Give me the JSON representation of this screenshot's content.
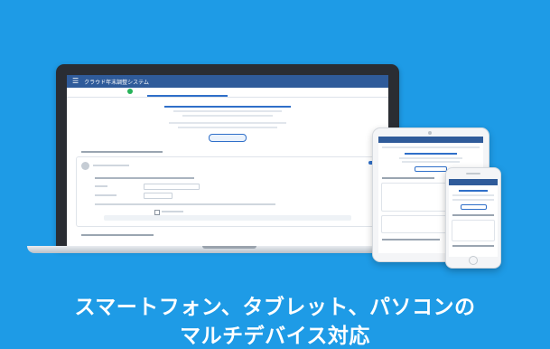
{
  "laptop": {
    "app_title": "クラウド年末調整システム",
    "steps": [
      "",
      "",
      "",
      ""
    ],
    "section_title": ""
  },
  "caption": {
    "line1": "スマートフォン、タブレット、パソコンの",
    "line2": "マルチデバイス対応"
  },
  "colors": {
    "background": "#1e9be6",
    "app_bar": "#2f5b9a",
    "accent": "#2f6fc9"
  }
}
